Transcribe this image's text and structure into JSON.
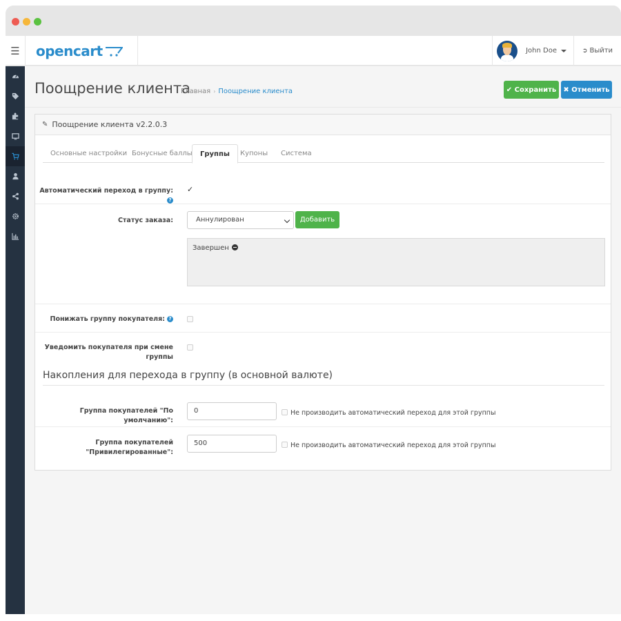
{
  "header": {
    "logo_text": "opencart",
    "user_name": "John Doe",
    "logout_label": "Выйти"
  },
  "sidebar": {
    "items": [
      "dashboard-icon",
      "tags-icon",
      "puzzle-icon",
      "desktop-icon",
      "shopping-cart-icon",
      "user-icon",
      "share-icon",
      "cog-icon",
      "bar-chart-icon"
    ],
    "active_index": 4
  },
  "page": {
    "title": "Поощрение клиента",
    "breadcrumb": [
      "Главная",
      "Поощрение клиента"
    ],
    "save_label": "Сохранить",
    "cancel_label": "Отменить"
  },
  "panel": {
    "heading": "Поощрение клиента v2.2.0.3",
    "tabs": [
      "Основные настройки",
      "Бонусные баллы",
      "Группы",
      "Купоны",
      "Система"
    ],
    "active_tab": "Группы"
  },
  "form": {
    "auto_transition_label": "Автоматический переход в группу:",
    "auto_transition_checked": true,
    "order_status_label": "Статус заказа:",
    "order_status_value": "Аннулирован",
    "add_label": "Добавить",
    "statuses": [
      "Завершен"
    ],
    "lower_group_label": "Понижать группу покупателя:",
    "notify_label_line1": "Уведомить покупателя при смене",
    "notify_label_line2": "группы",
    "section_title": "Накопления для перехода в группу (в основной валюте)",
    "default_group_label": "Группа покупателей \"По умолчанию\":",
    "default_group_value": "0",
    "privileged_group_label_line1": "Группа покупателей",
    "privileged_group_label_line2": "\"Привилегированные\":",
    "privileged_group_value": "500",
    "no_auto_label": "Не производить автоматический переход для этой группы"
  },
  "colors": {
    "primary": "#2a8ccb",
    "success": "#4fb34a",
    "sidebar": "#253241"
  }
}
